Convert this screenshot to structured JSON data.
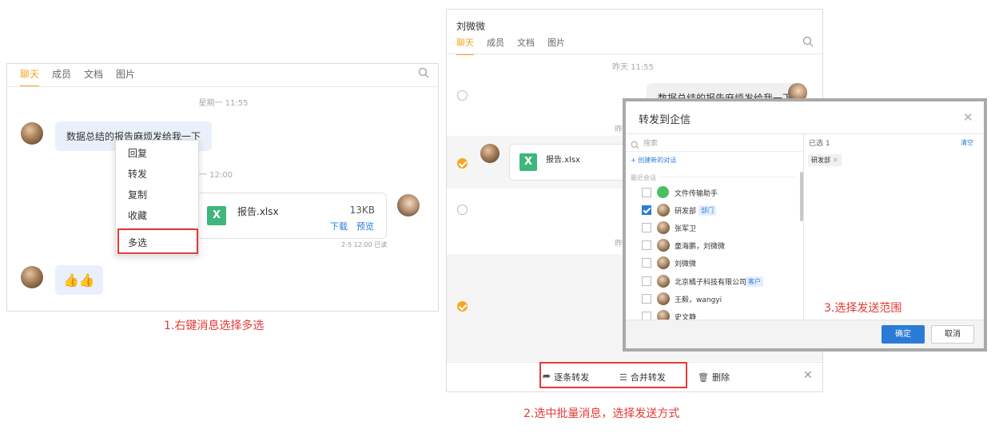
{
  "panel1": {
    "tabs": [
      "聊天",
      "成员",
      "文档",
      "图片"
    ],
    "time1": "星期一 11:55",
    "msg1": "数据总结的报告麻烦发给我一下",
    "time2": "星期一 12:00",
    "file": {
      "name": "报告.xlsx",
      "size": "13KB",
      "download": "下载",
      "preview": "预览",
      "meta": "2-5 12:00 已读"
    },
    "emoji": "👍👍",
    "context_menu": [
      "回复",
      "转发",
      "复制",
      "收藏",
      "多选"
    ],
    "caption": "1.右键消息选择多选"
  },
  "panel2": {
    "title": "刘微微",
    "tabs": [
      "聊天",
      "成员",
      "文档",
      "图片"
    ],
    "time1": "昨天 11:55",
    "msg1": "数据总结的报告麻烦发给我一下",
    "file_name": "报告.xlsx",
    "time_partial": "昨",
    "toolbar": {
      "forward_each": "逐条转发",
      "forward_merge": "合并转发",
      "delete": "删除"
    },
    "caption": "2.选中批量消息，选择发送方式"
  },
  "dialog": {
    "title": "转发到企信",
    "search_placeholder": "搜索",
    "selected_label": "已选 1",
    "clear": "清空",
    "create_chat": "+ 创建新的对话",
    "recent": "最近会话",
    "contacts": [
      {
        "name": "文件传输助手",
        "tag": ""
      },
      {
        "name": "研发部",
        "tag": "部门"
      },
      {
        "name": "张军卫",
        "tag": ""
      },
      {
        "name": "童海鹏，刘微微",
        "tag": ""
      },
      {
        "name": "刘微微",
        "tag": ""
      },
      {
        "name": "北京橘子科技有限公司",
        "tag": "客户"
      },
      {
        "name": "王毅，wangyi",
        "tag": ""
      },
      {
        "name": "史文静",
        "tag": ""
      }
    ],
    "selected_chip": "研发部",
    "ok": "确定",
    "cancel": "取消",
    "caption": "3.选择发送范围"
  },
  "colors": {
    "accent": "#f5a623",
    "annotation": "#e53935",
    "primary": "#2a7bd8"
  }
}
